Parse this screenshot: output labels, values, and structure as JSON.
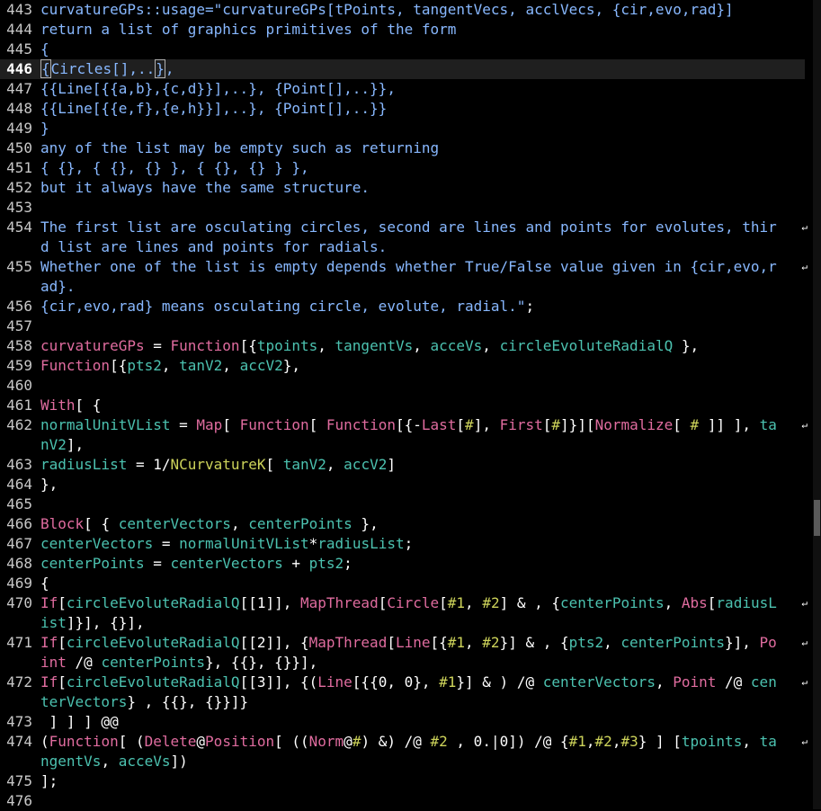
{
  "colors": {
    "background": "#000000",
    "line_number": "#c8c8c8",
    "keyword": "#e06c9f",
    "variable": "#4cc2b0",
    "argument": "#cdd35a",
    "string": "#88b8ff",
    "plain": "#ffffff"
  },
  "editor": {
    "current_line": "446",
    "wrap_marker": "↵",
    "lines": [
      {
        "num": "443",
        "segs": [
          [
            "s",
            "curvatureGPs::usage=\"curvatureGPs[tPoints, tangentVecs, acclVecs, {cir,evo,rad}]"
          ]
        ]
      },
      {
        "num": "444",
        "segs": [
          [
            "s",
            "return a list of graphics primitives of the form"
          ]
        ]
      },
      {
        "num": "445",
        "segs": [
          [
            "s",
            "{"
          ]
        ]
      },
      {
        "num": "446",
        "segs": [
          [
            "s",
            "{"
          ],
          [
            "s",
            "Circles[],.."
          ],
          [
            "s",
            "}"
          ],
          [
            "s",
            ","
          ]
        ]
      },
      {
        "num": "447",
        "segs": [
          [
            "s",
            "{{Line[{{a,b},{c,d}}],..}, {Point[],..}},"
          ]
        ]
      },
      {
        "num": "448",
        "segs": [
          [
            "s",
            "{{Line[{{e,f},{e,h}}],..}, {Point[],..}}"
          ]
        ]
      },
      {
        "num": "449",
        "segs": [
          [
            "s",
            "}"
          ]
        ]
      },
      {
        "num": "450",
        "segs": [
          [
            "s",
            "any of the list may be empty such as returning"
          ]
        ]
      },
      {
        "num": "451",
        "segs": [
          [
            "s",
            "{ {}, { {}, {} }, { {}, {} } },"
          ]
        ]
      },
      {
        "num": "452",
        "segs": [
          [
            "s",
            "but it always have the same structure."
          ]
        ]
      },
      {
        "num": "453",
        "segs": []
      },
      {
        "num": "454",
        "segs": [
          [
            "s",
            "The first list are osculating circles, second are lines and points for evolutes, thir"
          ]
        ],
        "wrap": true
      },
      {
        "num": "",
        "segs": [
          [
            "s",
            "d list are lines and points for radials."
          ]
        ]
      },
      {
        "num": "455",
        "segs": [
          [
            "s",
            "Whether one of the list is empty depends whether True/False value given in {cir,evo,r"
          ]
        ],
        "wrap": true
      },
      {
        "num": "",
        "segs": [
          [
            "s",
            "ad}."
          ]
        ]
      },
      {
        "num": "456",
        "segs": [
          [
            "s",
            "{cir,evo,rad} means osculating circle, evolute, radial.\""
          ],
          [
            "w",
            ";"
          ]
        ]
      },
      {
        "num": "457",
        "segs": []
      },
      {
        "num": "458",
        "segs": [
          [
            "k",
            "curvatureGPs"
          ],
          [
            "w",
            " = "
          ],
          [
            "k",
            "Function"
          ],
          [
            "w",
            "[{"
          ],
          [
            "g",
            "tpoints"
          ],
          [
            "w",
            ", "
          ],
          [
            "g",
            "tangentVs"
          ],
          [
            "w",
            ", "
          ],
          [
            "g",
            "acceVs"
          ],
          [
            "w",
            ", "
          ],
          [
            "g",
            "circleEvoluteRadialQ"
          ],
          [
            "w",
            " },"
          ]
        ]
      },
      {
        "num": "459",
        "segs": [
          [
            "k",
            "Function"
          ],
          [
            "w",
            "[{"
          ],
          [
            "g",
            "pts2"
          ],
          [
            "w",
            ", "
          ],
          [
            "g",
            "tanV2"
          ],
          [
            "w",
            ", "
          ],
          [
            "g",
            "accV2"
          ],
          [
            "w",
            "},"
          ]
        ]
      },
      {
        "num": "460",
        "segs": []
      },
      {
        "num": "461",
        "segs": [
          [
            "k",
            "With"
          ],
          [
            "w",
            "[ {"
          ]
        ]
      },
      {
        "num": "462",
        "segs": [
          [
            "g",
            "normalUnitVList"
          ],
          [
            "w",
            " = "
          ],
          [
            "k",
            "Map"
          ],
          [
            "w",
            "[ "
          ],
          [
            "k",
            "Function"
          ],
          [
            "w",
            "[ "
          ],
          [
            "k",
            "Function"
          ],
          [
            "w",
            "[{-"
          ],
          [
            "k",
            "Last"
          ],
          [
            "w",
            "["
          ],
          [
            "y",
            "#"
          ],
          [
            "w",
            "], "
          ],
          [
            "k",
            "First"
          ],
          [
            "w",
            "["
          ],
          [
            "y",
            "#"
          ],
          [
            "w",
            "]}]["
          ],
          [
            "k",
            "Normalize"
          ],
          [
            "w",
            "[ "
          ],
          [
            "y",
            "#"
          ],
          [
            "w",
            " ]] ], "
          ],
          [
            "g",
            "ta"
          ]
        ],
        "wrap": true
      },
      {
        "num": "",
        "segs": [
          [
            "g",
            "nV2"
          ],
          [
            "w",
            "],"
          ]
        ]
      },
      {
        "num": "463",
        "segs": [
          [
            "g",
            "radiusList"
          ],
          [
            "w",
            " = 1/"
          ],
          [
            "y",
            "NCurvatureK"
          ],
          [
            "w",
            "[ "
          ],
          [
            "g",
            "tanV2"
          ],
          [
            "w",
            ", "
          ],
          [
            "g",
            "accV2"
          ],
          [
            "w",
            "]"
          ]
        ]
      },
      {
        "num": "464",
        "segs": [
          [
            "w",
            "},"
          ]
        ]
      },
      {
        "num": "465",
        "segs": []
      },
      {
        "num": "466",
        "segs": [
          [
            "k",
            "Block"
          ],
          [
            "w",
            "[ { "
          ],
          [
            "g",
            "centerVectors"
          ],
          [
            "w",
            ", "
          ],
          [
            "g",
            "centerPoints"
          ],
          [
            "w",
            " },"
          ]
        ]
      },
      {
        "num": "467",
        "segs": [
          [
            "g",
            "centerVectors"
          ],
          [
            "w",
            " = "
          ],
          [
            "g",
            "normalUnitVList"
          ],
          [
            "w",
            "*"
          ],
          [
            "g",
            "radiusList"
          ],
          [
            "w",
            ";"
          ]
        ]
      },
      {
        "num": "468",
        "segs": [
          [
            "g",
            "centerPoints"
          ],
          [
            "w",
            " = "
          ],
          [
            "g",
            "centerVectors"
          ],
          [
            "w",
            " + "
          ],
          [
            "g",
            "pts2"
          ],
          [
            "w",
            ";"
          ]
        ]
      },
      {
        "num": "469",
        "segs": [
          [
            "w",
            "{"
          ]
        ]
      },
      {
        "num": "470",
        "segs": [
          [
            "k",
            "If"
          ],
          [
            "w",
            "["
          ],
          [
            "g",
            "circleEvoluteRadialQ"
          ],
          [
            "w",
            "[[1]], "
          ],
          [
            "k",
            "MapThread"
          ],
          [
            "w",
            "["
          ],
          [
            "k",
            "Circle"
          ],
          [
            "w",
            "["
          ],
          [
            "y",
            "#1"
          ],
          [
            "w",
            ", "
          ],
          [
            "y",
            "#2"
          ],
          [
            "w",
            "] & , {"
          ],
          [
            "g",
            "centerPoints"
          ],
          [
            "w",
            ", "
          ],
          [
            "k",
            "Abs"
          ],
          [
            "w",
            "["
          ],
          [
            "g",
            "radiusL"
          ]
        ],
        "wrap": true
      },
      {
        "num": "",
        "segs": [
          [
            "g",
            "ist"
          ],
          [
            "w",
            "]}], {}],"
          ]
        ]
      },
      {
        "num": "471",
        "segs": [
          [
            "k",
            "If"
          ],
          [
            "w",
            "["
          ],
          [
            "g",
            "circleEvoluteRadialQ"
          ],
          [
            "w",
            "[[2]], {"
          ],
          [
            "k",
            "MapThread"
          ],
          [
            "w",
            "["
          ],
          [
            "k",
            "Line"
          ],
          [
            "w",
            "[{"
          ],
          [
            "y",
            "#1"
          ],
          [
            "w",
            ", "
          ],
          [
            "y",
            "#2"
          ],
          [
            "w",
            "}] & , {"
          ],
          [
            "g",
            "pts2"
          ],
          [
            "w",
            ", "
          ],
          [
            "g",
            "centerPoints"
          ],
          [
            "w",
            "}], "
          ],
          [
            "k",
            "Po"
          ]
        ],
        "wrap": true
      },
      {
        "num": "",
        "segs": [
          [
            "k",
            "int"
          ],
          [
            "w",
            " /@ "
          ],
          [
            "g",
            "centerPoints"
          ],
          [
            "w",
            "}, {{}, {}}],"
          ]
        ]
      },
      {
        "num": "472",
        "segs": [
          [
            "k",
            "If"
          ],
          [
            "w",
            "["
          ],
          [
            "g",
            "circleEvoluteRadialQ"
          ],
          [
            "w",
            "[[3]], {("
          ],
          [
            "k",
            "Line"
          ],
          [
            "w",
            "[{{0, 0}, "
          ],
          [
            "y",
            "#1"
          ],
          [
            "w",
            "}] & ) /@ "
          ],
          [
            "g",
            "centerVectors"
          ],
          [
            "w",
            ", "
          ],
          [
            "k",
            "Point"
          ],
          [
            "w",
            " /@ "
          ],
          [
            "g",
            "cen"
          ]
        ],
        "wrap": true
      },
      {
        "num": "",
        "segs": [
          [
            "g",
            "terVectors"
          ],
          [
            "w",
            "} , {{}, {}}]}"
          ]
        ]
      },
      {
        "num": "473",
        "segs": [
          [
            "w",
            " ] ] ] @@"
          ]
        ]
      },
      {
        "num": "474",
        "segs": [
          [
            "w",
            "("
          ],
          [
            "k",
            "Function"
          ],
          [
            "w",
            "[ ("
          ],
          [
            "k",
            "Delete"
          ],
          [
            "w",
            "@"
          ],
          [
            "k",
            "Position"
          ],
          [
            "w",
            "[ (("
          ],
          [
            "k",
            "Norm"
          ],
          [
            "w",
            "@"
          ],
          [
            "y",
            "#"
          ],
          [
            "w",
            ") &) /@ "
          ],
          [
            "y",
            "#2"
          ],
          [
            "w",
            " , 0.|0]) /@ {"
          ],
          [
            "y",
            "#1"
          ],
          [
            "w",
            ","
          ],
          [
            "y",
            "#2"
          ],
          [
            "w",
            ","
          ],
          [
            "y",
            "#3"
          ],
          [
            "w",
            "} ] ["
          ],
          [
            "g",
            "tpoints"
          ],
          [
            "w",
            ", "
          ],
          [
            "g",
            "ta"
          ]
        ],
        "wrap": true
      },
      {
        "num": "",
        "segs": [
          [
            "g",
            "ngentVs"
          ],
          [
            "w",
            ", "
          ],
          [
            "g",
            "acceVs"
          ],
          [
            "w",
            "])"
          ]
        ]
      },
      {
        "num": "475",
        "segs": [
          [
            "w",
            "];"
          ]
        ]
      },
      {
        "num": "476",
        "segs": []
      }
    ]
  }
}
